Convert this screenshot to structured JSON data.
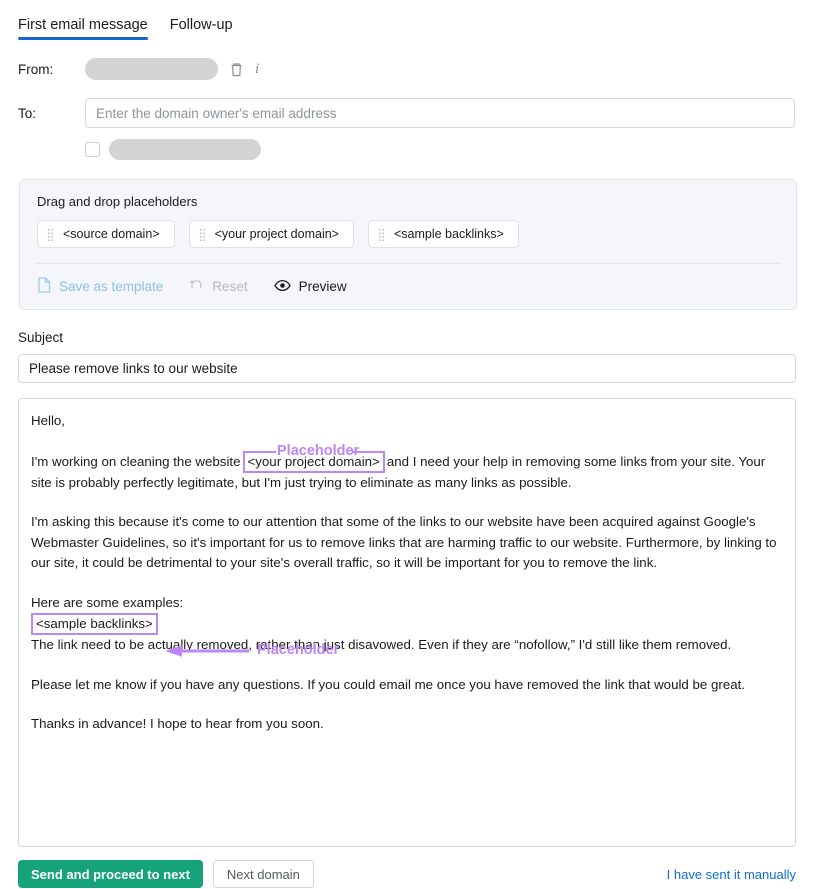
{
  "tabs": [
    {
      "label": "First email message",
      "active": true
    },
    {
      "label": "Follow-up",
      "active": false
    }
  ],
  "from": {
    "label": "From:",
    "value_redacted": "",
    "delete_icon": "trash-icon",
    "info_icon": "info-icon"
  },
  "to": {
    "label": "To:",
    "value": "",
    "placeholder": "Enter the domain owner's email address",
    "cc_checked": false,
    "cc_value_redacted": ""
  },
  "placeholders_panel": {
    "title": "Drag and drop placeholders",
    "chips": [
      "<source domain>",
      "<your project domain>",
      "<sample backlinks>"
    ],
    "actions": [
      {
        "label": "Save as template",
        "icon": "document-icon",
        "state": "disabled-blue"
      },
      {
        "label": "Reset",
        "icon": "undo-icon",
        "state": "disabled-gray"
      },
      {
        "label": "Preview",
        "icon": "eye-icon",
        "state": "normal"
      }
    ]
  },
  "subject": {
    "label": "Subject",
    "value": "Please remove links to our website"
  },
  "body": {
    "greeting": "Hello,",
    "p1_before": "I'm working on cleaning the website",
    "p1_token": "<your project domain>",
    "p1_after": "and I need your help in removing some links from your site. Your site is probably perfectly legitimate, but I'm just trying to eliminate as many links as possible.",
    "p2": "I'm asking this because it's come to our attention that some of the links to our website have been acquired against Google's Webmaster Guidelines, so it's important for us to remove links that are harming traffic to our website. Furthermore, by linking to our site, it could be detrimental to your site's overall traffic, so it will be important for you to remove the link.",
    "p3_intro": "Here are some examples:",
    "p3_token": "<sample backlinks>",
    "p3_rest": "The link need to be actually removed, rather than just disavowed. Even if they are “nofollow,” I'd still like them removed.",
    "p4": "Please let me know if you have any questions. If you could email me once you have removed the link that would be great.",
    "p5": "Thanks in advance! I hope to hear from you soon."
  },
  "annotations": {
    "caption_1": "Placeholder",
    "caption_2": "Placeholder",
    "color": "#bb86f5"
  },
  "footer": {
    "send_label": "Send and proceed to next",
    "next_label": "Next domain",
    "manual_label": "I have sent it manually",
    "send_color": "#16a37b",
    "link_color": "#0e6ed4"
  }
}
